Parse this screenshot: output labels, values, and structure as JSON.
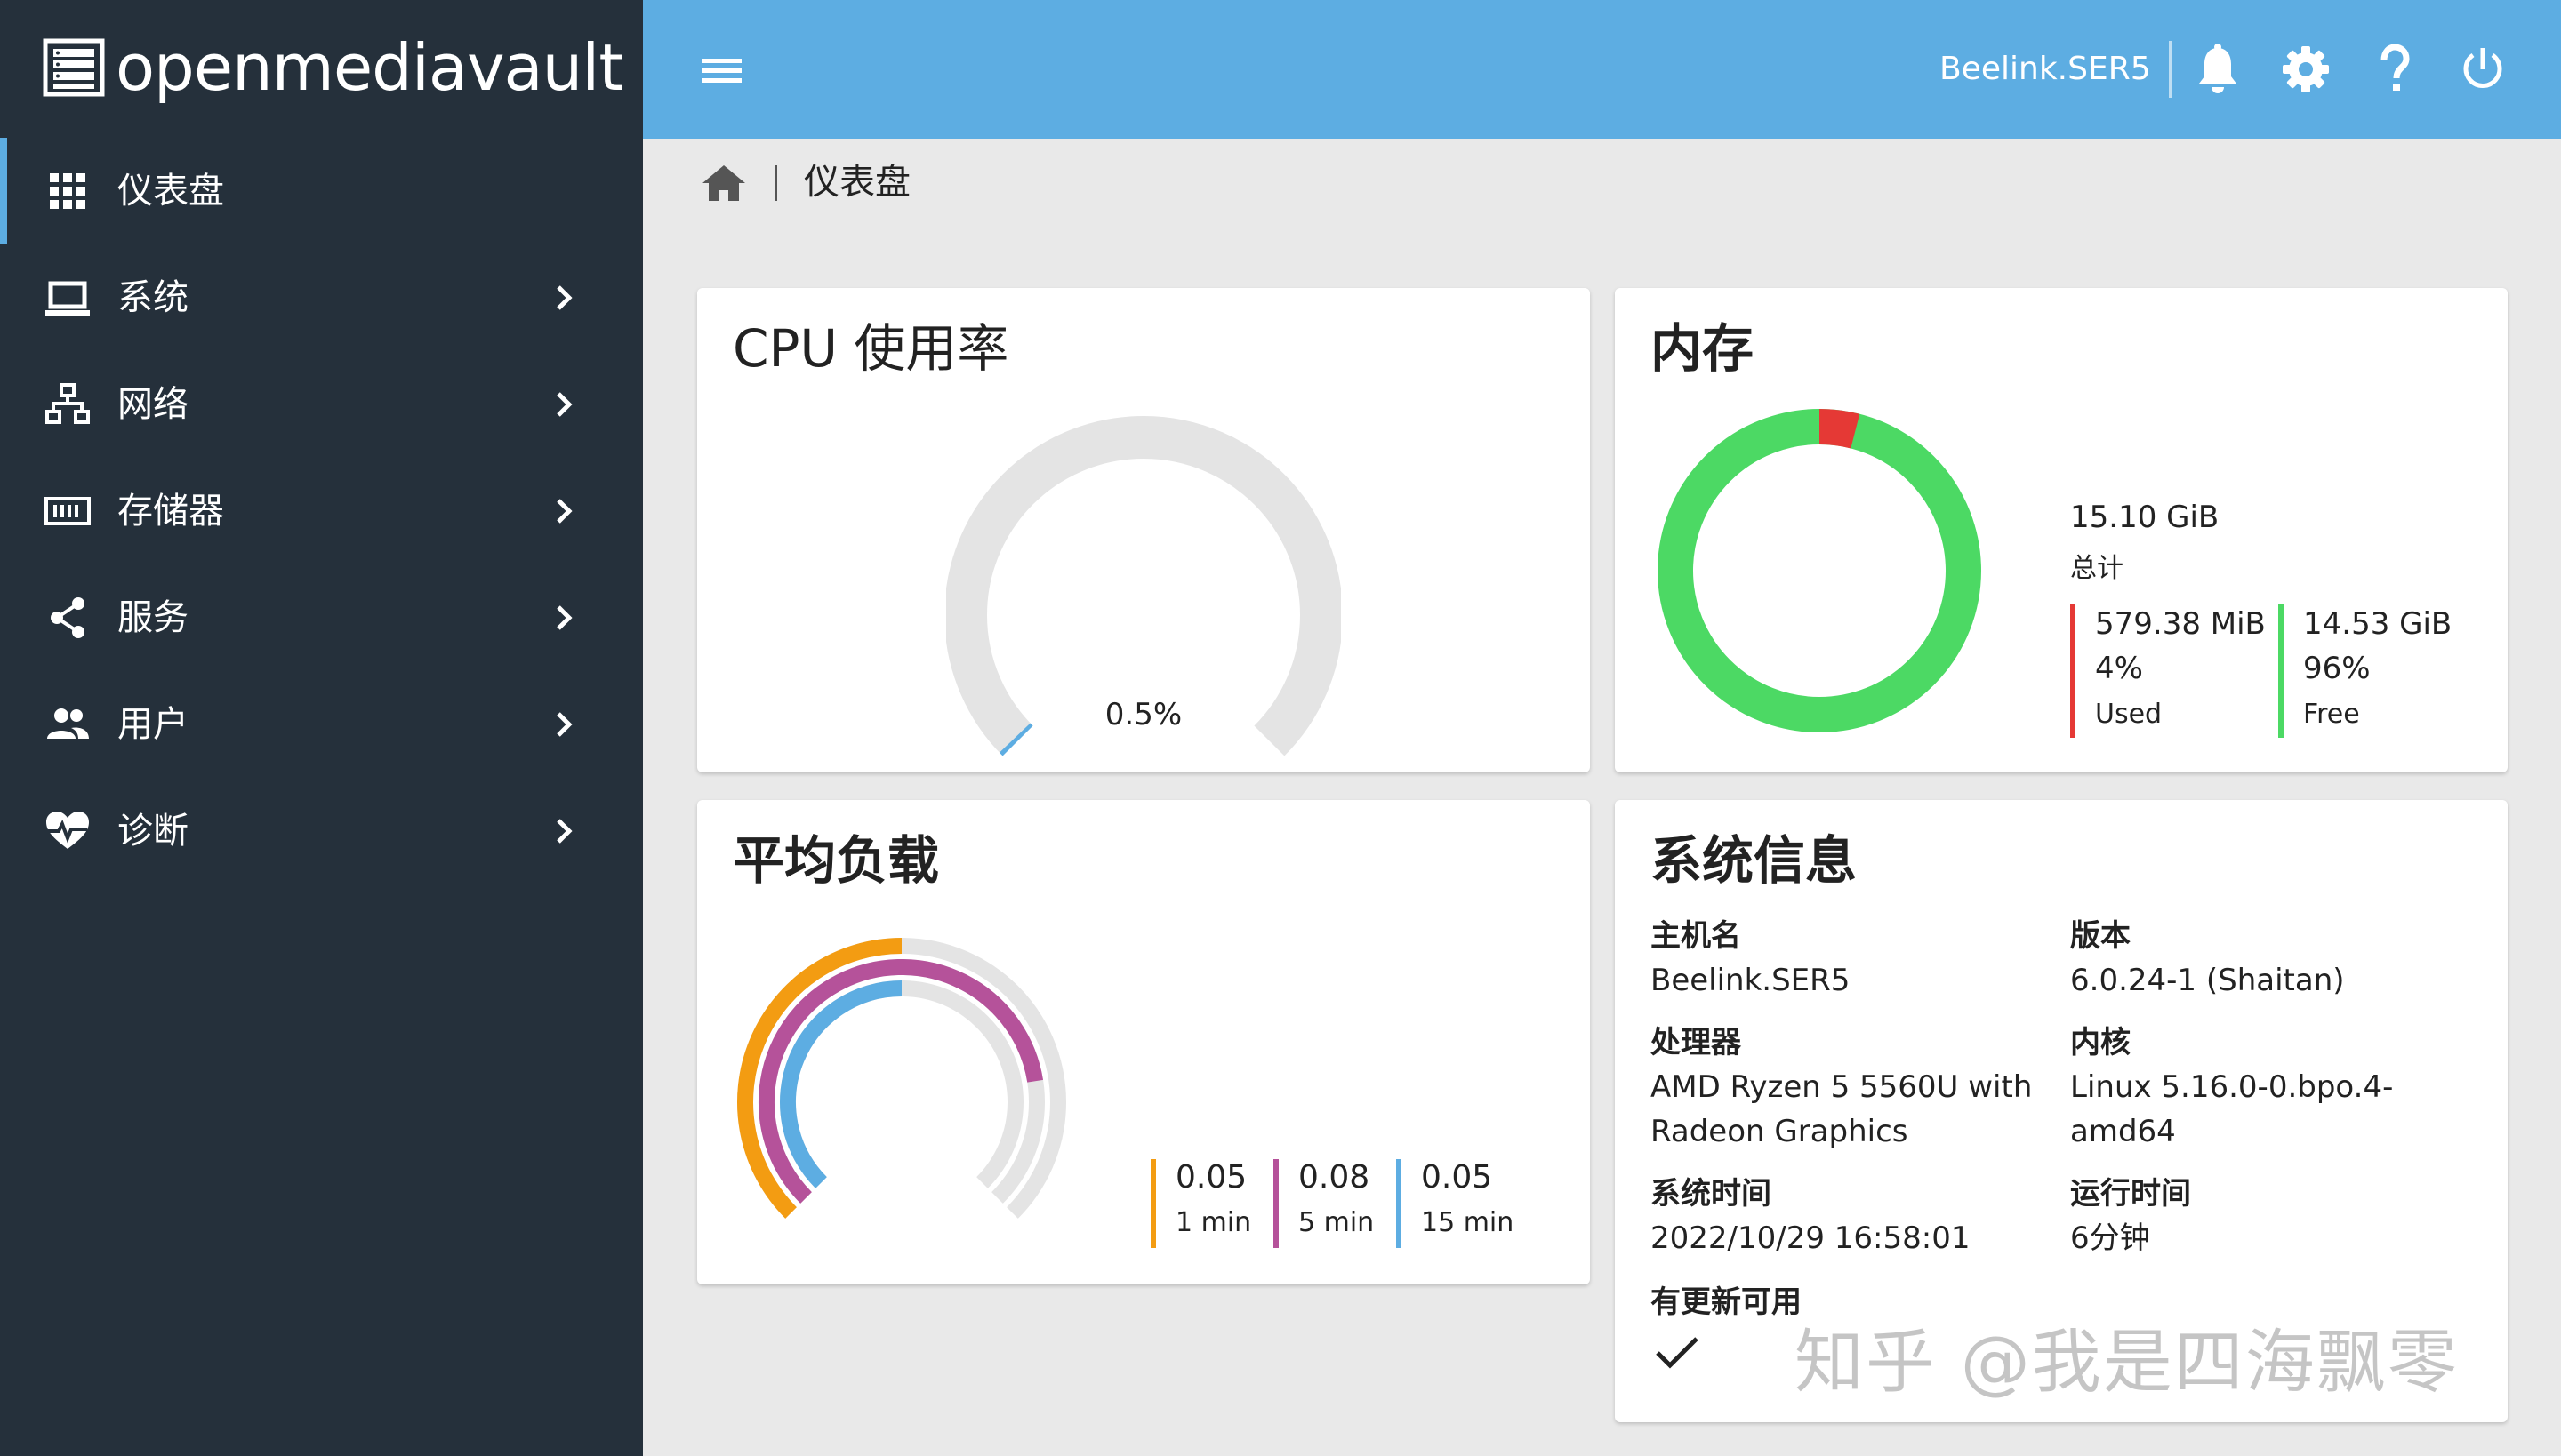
{
  "app": {
    "brand": "openmediavault"
  },
  "sidebar": {
    "items": [
      {
        "label": "仪表盘",
        "icon": "apps-grid-icon",
        "active": true
      },
      {
        "label": "系统",
        "icon": "laptop-icon"
      },
      {
        "label": "网络",
        "icon": "network-icon"
      },
      {
        "label": "存储器",
        "icon": "storage-icon"
      },
      {
        "label": "服务",
        "icon": "share-icon"
      },
      {
        "label": "用户",
        "icon": "users-icon"
      },
      {
        "label": "诊断",
        "icon": "heart-pulse-icon"
      }
    ]
  },
  "topbar": {
    "hostname": "Beelink.SER5",
    "icons": [
      "menu-icon",
      "bell-icon",
      "gear-icon",
      "help-icon",
      "power-icon"
    ]
  },
  "breadcrumb": {
    "current": "仪表盘"
  },
  "cpu": {
    "title": "CPU 使用率",
    "value_label": "0.5%",
    "percent": 0.5
  },
  "memory": {
    "title": "内存",
    "total": "15.10 GiB",
    "total_label": "总计",
    "used": {
      "value": "579.38 MiB",
      "percent": "4%",
      "label": "Used",
      "color": "#e53935"
    },
    "free": {
      "value": "14.53 GiB",
      "percent": "96%",
      "label": "Free",
      "color": "#4cd964"
    }
  },
  "load": {
    "title": "平均负载",
    "items": [
      {
        "value": "0.05",
        "label": "1 min",
        "color": "#f39c12"
      },
      {
        "value": "0.08",
        "label": "5 min",
        "color": "#b5529a"
      },
      {
        "value": "0.05",
        "label": "15 min",
        "color": "#5dade2"
      }
    ]
  },
  "sysinfo": {
    "title": "系统信息",
    "hostname_label": "主机名",
    "hostname": "Beelink.SER5",
    "version_label": "版本",
    "version": "6.0.24-1 (Shaitan)",
    "cpu_label": "处理器",
    "cpu": "AMD Ryzen 5 5560U with\nRadeon Graphics",
    "kernel_label": "内核",
    "kernel": "Linux 5.16.0-0.bpo.4-\namd64",
    "time_label": "系统时间",
    "time": "2022/10/29 16:58:01",
    "uptime_label": "运行时间",
    "uptime": "6分钟",
    "updates_label": "有更新可用",
    "updates_icon": "check-icon"
  },
  "watermark": "知乎 @我是四海飘零"
}
